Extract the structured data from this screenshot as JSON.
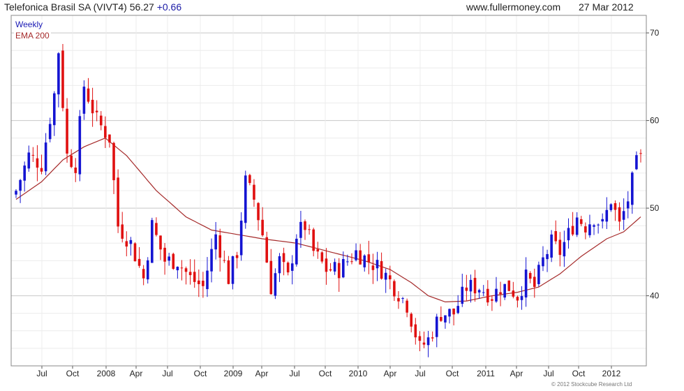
{
  "header": {
    "security": "Telefonica Brasil SA (VIVT4)",
    "price": "56.27",
    "change": "+0.66",
    "source": "www.fullermoney.com",
    "date": "27 Mar 2012"
  },
  "copyright": "© 2012 Stockcube Research Ltd",
  "chart_data": {
    "type": "candlestick",
    "legend": [
      "Weekly",
      "EMA 200"
    ],
    "colors": {
      "up": "#1414d2",
      "down": "#e01010",
      "ema": "#a52a2a",
      "grid": "#d6d6d6"
    },
    "ylim": [
      32,
      72
    ],
    "y_ticks": [
      40,
      50,
      60,
      70
    ],
    "x_ticks": [
      "Jul",
      "Oct",
      "2008",
      "Apr",
      "Jul",
      "Oct",
      "2009",
      "Apr",
      "Jul",
      "Oct",
      "2010",
      "Apr",
      "Jul",
      "Oct",
      "2011",
      "Apr",
      "Jul",
      "Oct",
      "2012"
    ],
    "close_anchors": [
      {
        "week": 0,
        "close": 52
      },
      {
        "week": 3,
        "close": 56
      },
      {
        "week": 6,
        "close": 55
      },
      {
        "week": 9,
        "close": 63
      },
      {
        "week": 10,
        "close": 68
      },
      {
        "week": 12,
        "close": 56
      },
      {
        "week": 14,
        "close": 55
      },
      {
        "week": 16,
        "close": 64
      },
      {
        "week": 19,
        "close": 60
      },
      {
        "week": 22,
        "close": 58
      },
      {
        "week": 24,
        "close": 48
      },
      {
        "week": 27,
        "close": 46
      },
      {
        "week": 30,
        "close": 42
      },
      {
        "week": 32,
        "close": 48
      },
      {
        "week": 35,
        "close": 44
      },
      {
        "week": 38,
        "close": 44
      },
      {
        "week": 41,
        "close": 42
      },
      {
        "week": 44,
        "close": 41
      },
      {
        "week": 47,
        "close": 47
      },
      {
        "week": 50,
        "close": 42
      },
      {
        "week": 52,
        "close": 45
      },
      {
        "week": 54,
        "close": 53
      },
      {
        "week": 56,
        "close": 51
      },
      {
        "week": 58,
        "close": 47
      },
      {
        "week": 60,
        "close": 41
      },
      {
        "week": 62,
        "close": 44
      },
      {
        "week": 64,
        "close": 42
      },
      {
        "week": 66,
        "close": 47
      },
      {
        "week": 68,
        "close": 48
      },
      {
        "week": 70,
        "close": 45
      },
      {
        "week": 73,
        "close": 43
      },
      {
        "week": 76,
        "close": 43
      },
      {
        "week": 78,
        "close": 44
      },
      {
        "week": 80,
        "close": 45
      },
      {
        "week": 83,
        "close": 44
      },
      {
        "week": 86,
        "close": 43
      },
      {
        "week": 89,
        "close": 41
      },
      {
        "week": 92,
        "close": 39
      },
      {
        "week": 95,
        "close": 34
      },
      {
        "week": 97,
        "close": 35
      },
      {
        "week": 100,
        "close": 38
      },
      {
        "week": 103,
        "close": 38
      },
      {
        "week": 106,
        "close": 41
      },
      {
        "week": 109,
        "close": 41
      },
      {
        "week": 112,
        "close": 40
      },
      {
        "week": 114,
        "close": 41
      },
      {
        "week": 116,
        "close": 41
      },
      {
        "week": 118,
        "close": 40
      },
      {
        "week": 120,
        "close": 42
      },
      {
        "week": 122,
        "close": 41
      },
      {
        "week": 124,
        "close": 44
      },
      {
        "week": 126,
        "close": 46
      },
      {
        "week": 128,
        "close": 45
      },
      {
        "week": 130,
        "close": 47
      },
      {
        "week": 132,
        "close": 49
      },
      {
        "week": 134,
        "close": 48
      },
      {
        "week": 136,
        "close": 49
      },
      {
        "week": 138,
        "close": 48
      },
      {
        "week": 140,
        "close": 51
      },
      {
        "week": 142,
        "close": 48
      },
      {
        "week": 144,
        "close": 51
      },
      {
        "week": 146,
        "close": 55
      },
      {
        "week": 147,
        "close": 56.27
      }
    ],
    "ema_anchors": [
      {
        "week": 0,
        "value": 51
      },
      {
        "week": 6,
        "value": 53
      },
      {
        "week": 11,
        "value": 55.5
      },
      {
        "week": 16,
        "value": 57
      },
      {
        "week": 21,
        "value": 58
      },
      {
        "week": 26,
        "value": 56
      },
      {
        "week": 33,
        "value": 52
      },
      {
        "week": 40,
        "value": 49
      },
      {
        "week": 46,
        "value": 47.5
      },
      {
        "week": 52,
        "value": 47
      },
      {
        "week": 58,
        "value": 46.5
      },
      {
        "week": 66,
        "value": 46
      },
      {
        "week": 74,
        "value": 45
      },
      {
        "week": 82,
        "value": 44
      },
      {
        "week": 88,
        "value": 43
      },
      {
        "week": 93,
        "value": 41.5
      },
      {
        "week": 97,
        "value": 40
      },
      {
        "week": 101,
        "value": 39.3
      },
      {
        "week": 106,
        "value": 39.4
      },
      {
        "week": 112,
        "value": 40
      },
      {
        "week": 118,
        "value": 40.4
      },
      {
        "week": 123,
        "value": 41
      },
      {
        "week": 128,
        "value": 42.5
      },
      {
        "week": 133,
        "value": 44.5
      },
      {
        "week": 139,
        "value": 46.5
      },
      {
        "week": 143,
        "value": 47.3
      },
      {
        "week": 147,
        "value": 49
      }
    ]
  }
}
